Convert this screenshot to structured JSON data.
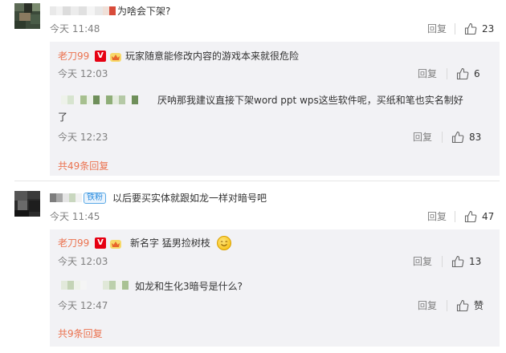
{
  "comments": [
    {
      "text": "为啥会下架?",
      "time": "今天 11:48",
      "reply_label": "回复",
      "likes": "23",
      "replies": [
        {
          "name": "老刀99",
          "text": "玩家随意能修改内容的游戏本来就很危险",
          "time": "今天 12:03",
          "reply_label": "回复",
          "likes": "6"
        },
        {
          "text_line1": "厌呐那我建议直接下架word ppt wps这些软件呢，买纸和笔也实名制好",
          "text_line2": "了",
          "time": "今天 12:23",
          "reply_label": "回复",
          "likes": "83"
        }
      ],
      "more_label": "共49条回复"
    },
    {
      "fan_badge": "铁粉",
      "text": "以后要买实体就跟如龙一样对暗号吧",
      "time": "今天 11:45",
      "reply_label": "回复",
      "likes": "47",
      "replies": [
        {
          "name": "老刀99",
          "text": "新名字 猛男捡树枝",
          "time": "今天 12:03",
          "reply_label": "回复",
          "likes": "13"
        },
        {
          "text": "如龙和生化3暗号是什么?",
          "time": "今天 12:47",
          "reply_label": "回复",
          "likes": "赞"
        }
      ],
      "more_label": "共9条回复"
    }
  ],
  "colors": {
    "accent": "#eb7350",
    "subbox_bg": "#f2f2f5",
    "meta_text": "#808080"
  }
}
